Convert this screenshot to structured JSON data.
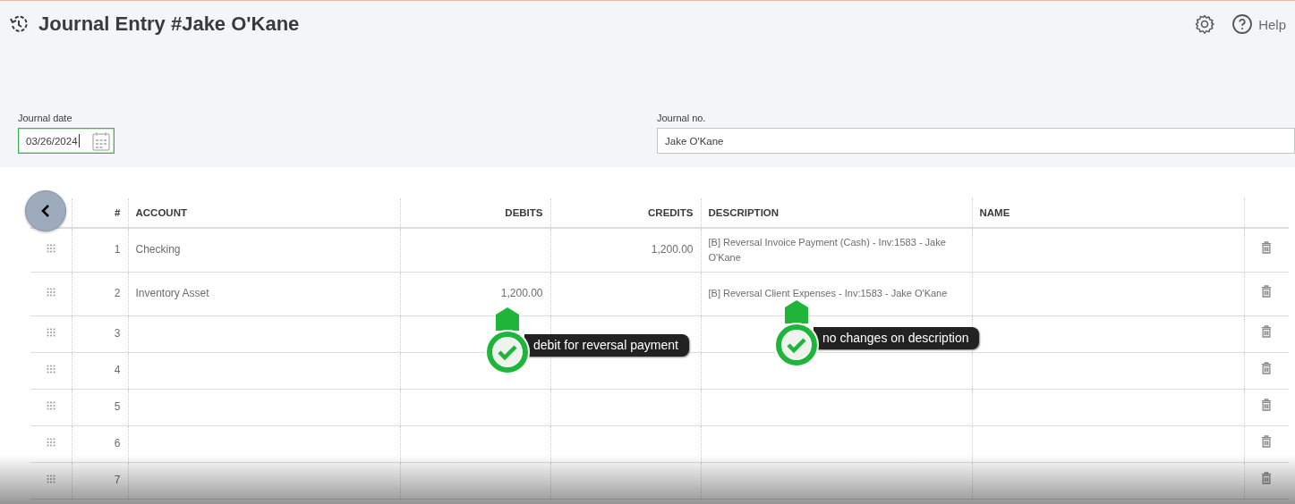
{
  "header": {
    "title": "Journal Entry #Jake O'Kane",
    "help_label": "Help"
  },
  "fields": [
    {
      "label": "Journal date",
      "value": "03/26/2024",
      "focused": true,
      "kind": "date"
    },
    {
      "label": "Journal no.",
      "value": "Jake O'Kane",
      "focused": false,
      "kind": "text"
    }
  ],
  "table": {
    "columns": [
      "#",
      "ACCOUNT",
      "DEBITS",
      "CREDITS",
      "DESCRIPTION",
      "NAME"
    ],
    "rows": [
      {
        "number": "1",
        "account": "Checking",
        "debits": "",
        "credits": "1,200.00",
        "description": "[B] Reversal Invoice Payment (Cash) - Inv:1583 - Jake O'Kane",
        "name": ""
      },
      {
        "number": "2",
        "account": "Inventory Asset",
        "debits": "1,200.00",
        "credits": "",
        "description": "[B] Reversal Client Expenses - Inv:1583 - Jake O'Kane",
        "name": ""
      },
      {
        "number": "3",
        "account": "",
        "debits": "",
        "credits": "",
        "description": "",
        "name": ""
      },
      {
        "number": "4",
        "account": "",
        "debits": "",
        "credits": "",
        "description": "",
        "name": ""
      },
      {
        "number": "5",
        "account": "",
        "debits": "",
        "credits": "",
        "description": "",
        "name": ""
      },
      {
        "number": "6",
        "account": "",
        "debits": "",
        "credits": "",
        "description": "",
        "name": ""
      },
      {
        "number": "7",
        "account": "",
        "debits": "",
        "credits": "",
        "description": "",
        "name": ""
      }
    ]
  },
  "callouts": [
    {
      "text": "debit for reversal payment"
    },
    {
      "text": "no changes on description"
    }
  ]
}
